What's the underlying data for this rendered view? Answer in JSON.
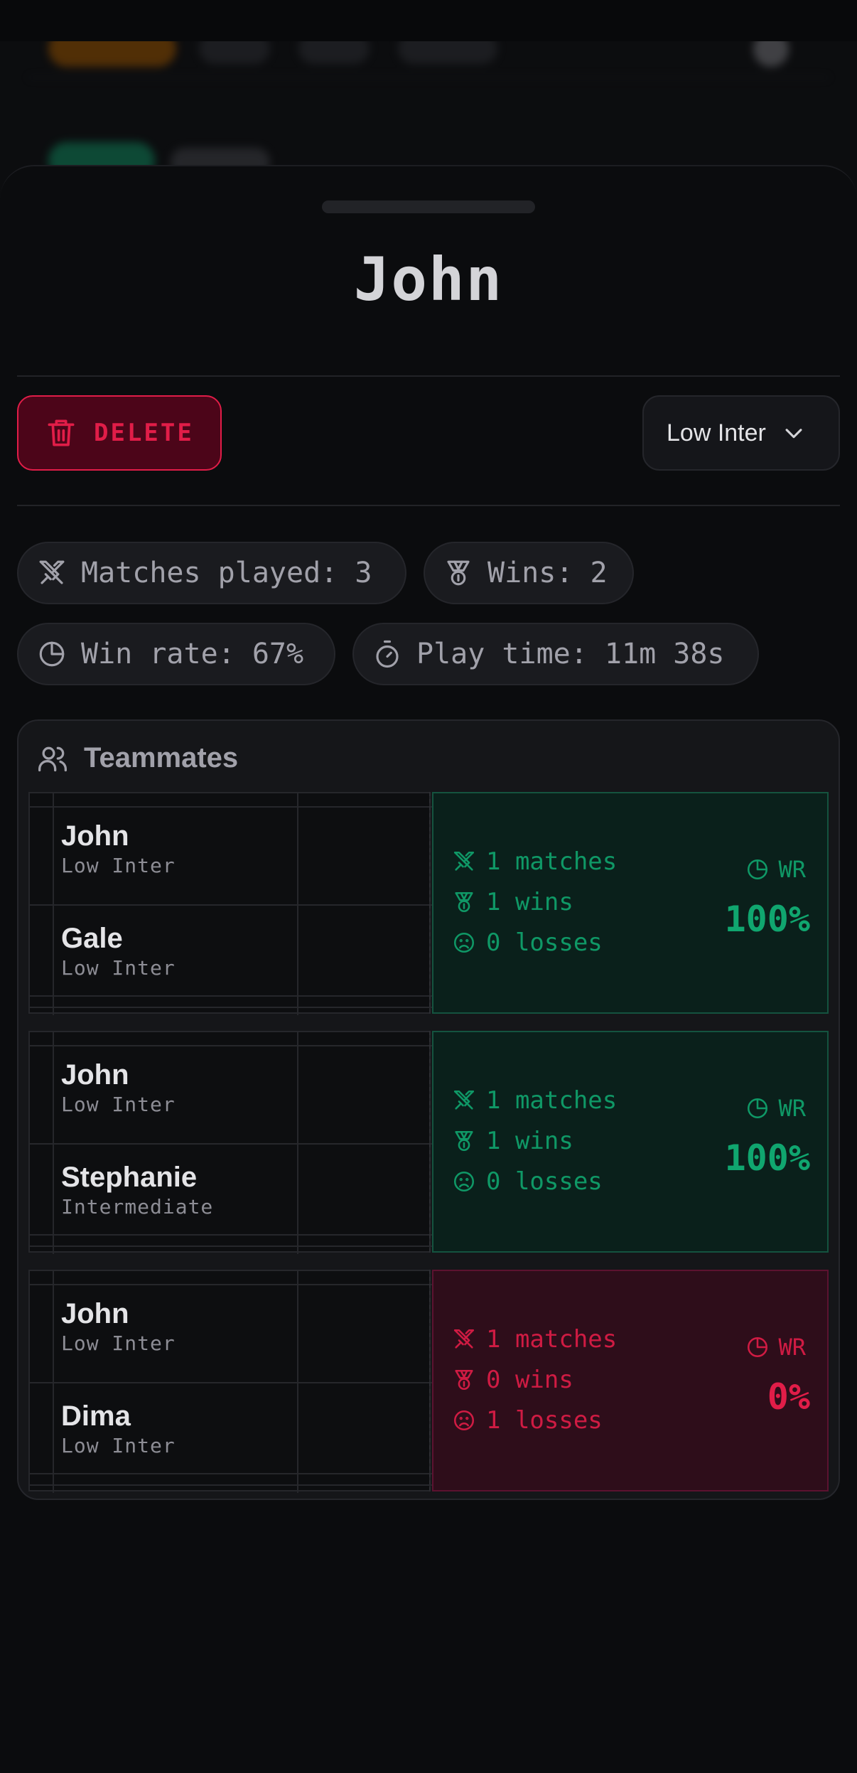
{
  "sheet": {
    "title": "John",
    "delete_label": "DELETE",
    "level_select": "Low Inter"
  },
  "stats": {
    "matches_played": "Matches played: 3",
    "wins": "Wins: 2",
    "win_rate": "Win rate: 67%",
    "play_time": "Play time: 11m 38s"
  },
  "teammates": {
    "header": "Teammates",
    "wr_label": "WR",
    "pairs": [
      {
        "p1_name": "John",
        "p1_level": "Low Inter",
        "p2_name": "Gale",
        "p2_level": "Low Inter",
        "matches": "1 matches",
        "wins": "1 wins",
        "losses": "0 losses",
        "wr": "100%",
        "result": "win"
      },
      {
        "p1_name": "John",
        "p1_level": "Low Inter",
        "p2_name": "Stephanie",
        "p2_level": "Intermediate",
        "matches": "1 matches",
        "wins": "1 wins",
        "losses": "0 losses",
        "wr": "100%",
        "result": "win"
      },
      {
        "p1_name": "John",
        "p1_level": "Low Inter",
        "p2_name": "Dima",
        "p2_level": "Low Inter",
        "matches": "1 matches",
        "wins": "0 wins",
        "losses": "1 losses",
        "wr": "0%",
        "result": "loss"
      }
    ]
  },
  "colors": {
    "win": "#10a66f",
    "loss": "#e11d48",
    "background": "#0b0c0e"
  }
}
